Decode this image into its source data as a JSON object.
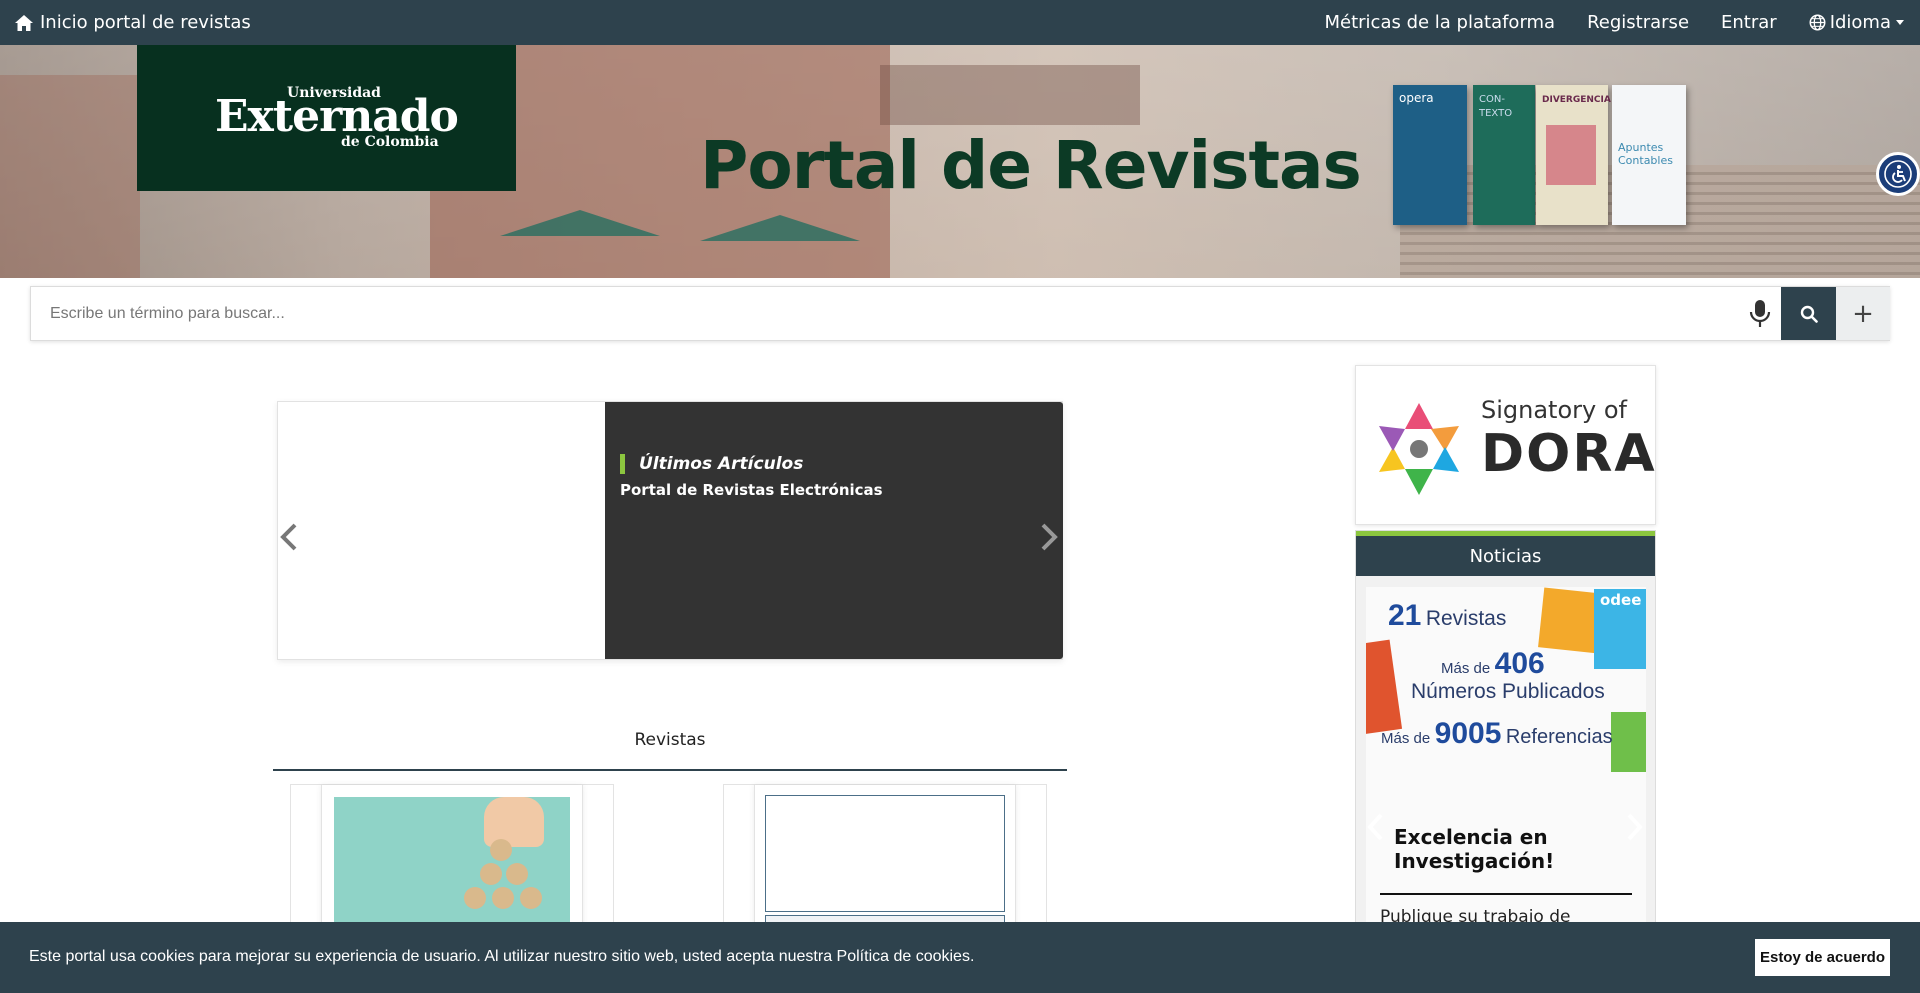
{
  "topnav": {
    "home_label": "Inicio portal de revistas",
    "links": [
      "Métricas de la plataforma",
      "Registrarse",
      "Entrar"
    ],
    "language_label": "Idioma"
  },
  "banner": {
    "logo_universidad": "Universidad",
    "logo_externado": "Externado",
    "logo_colombia": "de Colombia",
    "title": "Portal de Revistas",
    "books": [
      {
        "label": "opera",
        "color": "#1e5f86"
      },
      {
        "label": "CON-TEXTO",
        "color": "#1e6c5a"
      },
      {
        "label": "DIVERGENCIA",
        "color": "#e8e1c9"
      },
      {
        "label": "Apuntes Contables",
        "color": "#f4f6f8"
      }
    ]
  },
  "search": {
    "placeholder": "Escribe un término para buscar...",
    "plus_label": "+"
  },
  "carousel": {
    "tag": "Últimos Artículos",
    "subtitle": "Portal de Revistas Electrónicas",
    "prev": "‹",
    "next": "›"
  },
  "revistas": {
    "title": "Revistas"
  },
  "sidebar": {
    "dora_signatory": "Signatory of",
    "dora_word": "DORA",
    "news_title": "Noticias",
    "stat_revistas_num": "21",
    "stat_revistas_label": "Revistas",
    "stat_numeros_prefix": "Más de",
    "stat_numeros_num": "406",
    "stat_numeros_label": "Números Publicados",
    "stat_refs_prefix": "Más de",
    "stat_refs_num": "9005",
    "stat_refs_label": "Referencias",
    "headline": "Excelencia en Investigación!",
    "paragraph": "Publique su trabajo de investigación en las diferentes",
    "chip_label": "odee"
  },
  "cookie": {
    "message": "Este portal usa cookies para mejorar su experiencia de usuario. Al utilizar nuestro sitio web, usted acepta nuestra Política de cookies.",
    "accept": "Estoy de acuerdo"
  },
  "colors": {
    "nav": "#2e424d",
    "accent_green": "#8cc63f",
    "logo_green": "#07301f"
  },
  "icons": [
    "home-icon",
    "globe-icon",
    "microphone-icon",
    "search-icon",
    "accessibility-icon",
    "chevron-left-icon",
    "chevron-right-icon"
  ]
}
